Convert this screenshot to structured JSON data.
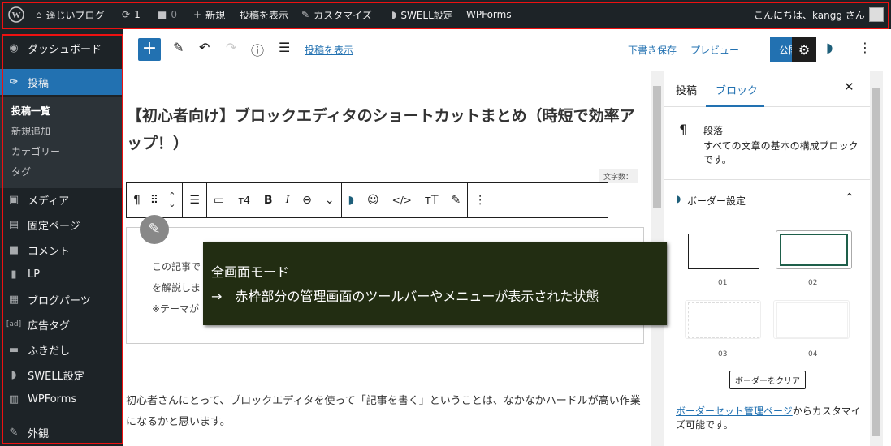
{
  "admin_bar": {
    "site_name": "遥じいブログ",
    "updates_count": "1",
    "comments_count": "0",
    "new_label": "新規",
    "view_post_label": "投稿を表示",
    "customize_label": "カスタマイズ",
    "swell_settings_label": "SWELL設定",
    "wpforms_label": "WPForms",
    "greeting": "こんにちは、kangg さん"
  },
  "sidebar": {
    "items": [
      {
        "icon": "dashboard-icon",
        "label": "ダッシュボード"
      },
      {
        "icon": "pin-icon",
        "label": "投稿",
        "active": true
      },
      {
        "icon": "media-icon",
        "label": "メディア"
      },
      {
        "icon": "pages-icon",
        "label": "固定ページ"
      },
      {
        "icon": "comment-icon",
        "label": "コメント"
      },
      {
        "icon": "lp-icon",
        "label": "LP"
      },
      {
        "icon": "blog-parts-icon",
        "label": "ブログパーツ"
      },
      {
        "icon": "ad-tag-icon",
        "label": "広告タグ"
      },
      {
        "icon": "balloon-icon",
        "label": "ふきだし"
      },
      {
        "icon": "swell-icon",
        "label": "SWELL設定"
      },
      {
        "icon": "wpforms-icon",
        "label": "WPForms"
      },
      {
        "icon": "appearance-icon",
        "label": "外観"
      }
    ],
    "submenu": [
      "投稿一覧",
      "新規追加",
      "カテゴリー",
      "タグ"
    ]
  },
  "editor_toolbar": {
    "view_post_link": "投稿を表示",
    "save_draft": "下書き保存",
    "preview": "プレビュー",
    "publish": "公開"
  },
  "post": {
    "title": "【初心者向け】ブロックエディタのショートカットまとめ（時短で効率アップ！）",
    "word_count_label": "文字数：",
    "box_lines": [
      "この記事で",
      "を解説しま",
      "※テーマが"
    ],
    "paragraph": "初心者さんにとって、ブロックエディタを使って「記事を書く」ということは、なかなかハードルが高い作業になるかと思います。"
  },
  "overlay": {
    "line1": "全画面モード",
    "line2": "→　赤枠部分の管理画面のツールバーやメニューが表示された状態"
  },
  "right_panel": {
    "tab_post": "投稿",
    "tab_block": "ブロック",
    "block_name": "段落",
    "block_desc": "すべての文章の基本の構成ブロックです。",
    "section_title": "ボーダー設定",
    "presets": [
      "01",
      "02",
      "03",
      "04"
    ],
    "clear_button": "ボーダーをクリア",
    "manage_link": "ボーダーセット管理ページ",
    "manage_suffix": "からカスタマイズ可能です。"
  },
  "colors": {
    "accent": "#2271b1",
    "admin_bar": "#1d2327",
    "frame": "#ee1111",
    "overlay_bg": "#222d12"
  }
}
